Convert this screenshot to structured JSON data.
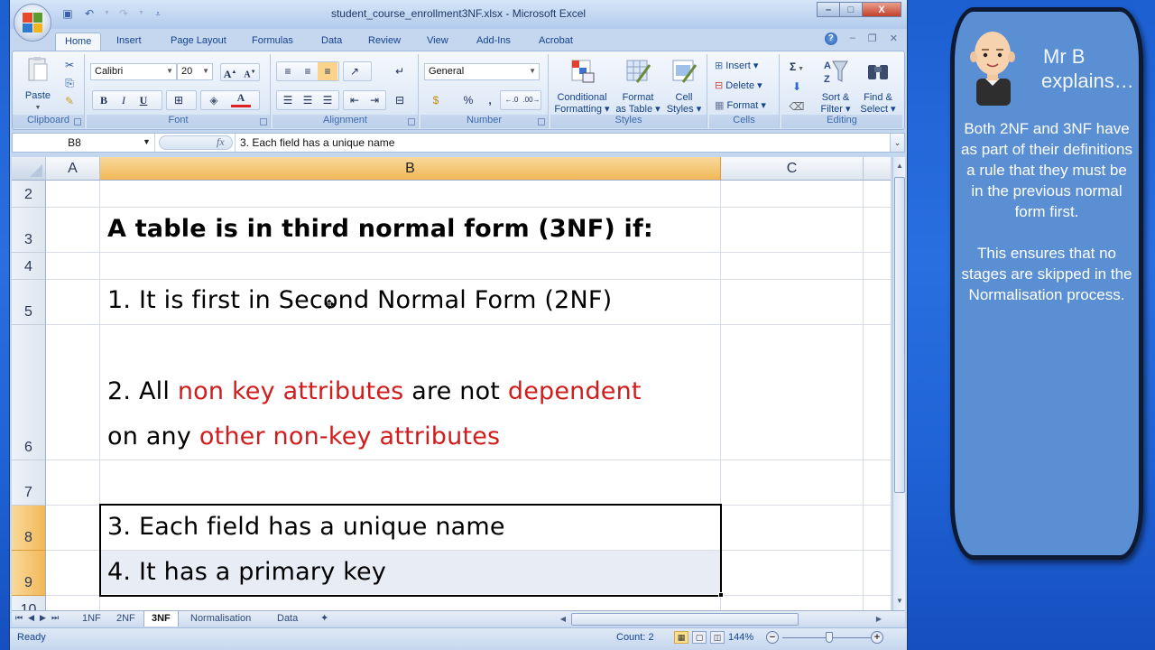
{
  "window": {
    "title": "student_course_enrollment3NF.xlsx - Microsoft Excel",
    "controls": {
      "minimize": "–",
      "maximize": "□",
      "close": "X"
    }
  },
  "quick_access": [
    "save-icon",
    "undo-icon",
    "redo-icon",
    "customize-icon"
  ],
  "ribbon_tabs": [
    {
      "label": "Home",
      "active": true
    },
    {
      "label": "Insert"
    },
    {
      "label": "Page Layout"
    },
    {
      "label": "Formulas"
    },
    {
      "label": "Data"
    },
    {
      "label": "Review"
    },
    {
      "label": "View"
    },
    {
      "label": "Add-Ins"
    },
    {
      "label": "Acrobat"
    }
  ],
  "ribbon": {
    "clipboard": {
      "label": "Clipboard",
      "paste": "Paste"
    },
    "font": {
      "label": "Font",
      "family": "Calibri",
      "size": "20",
      "bold": "B",
      "italic": "I",
      "underline": "U",
      "grow": "A",
      "shrink": "A",
      "font_color": "#e02020"
    },
    "alignment": {
      "label": "Alignment"
    },
    "number": {
      "label": "Number",
      "format": "General",
      "percent": "%",
      "comma": ","
    },
    "styles": {
      "label": "Styles",
      "conditional": [
        "Conditional",
        "Formatting ▾"
      ],
      "format_table": [
        "Format",
        "as Table ▾"
      ],
      "cell_styles": [
        "Cell",
        "Styles ▾"
      ]
    },
    "cells": {
      "label": "Cells",
      "insert": "Insert ▾",
      "delete": "Delete ▾",
      "format": "Format ▾"
    },
    "editing": {
      "label": "Editing",
      "sum": "Σ",
      "sort": [
        "Sort &",
        "Filter ▾"
      ],
      "find": [
        "Find &",
        "Select ▾"
      ]
    }
  },
  "formula_bar": {
    "name_box": "B8",
    "fx": "fx",
    "value": "3. Each field has a unique name"
  },
  "grid": {
    "columns": [
      "A",
      "B",
      "C"
    ],
    "selected_column": "B",
    "rows": [
      "2",
      "3",
      "4",
      "5",
      "6",
      "7",
      "8",
      "9",
      "10"
    ],
    "selected_rows": [
      "8",
      "9"
    ],
    "cells": {
      "b3": "A table is in third normal form (3NF) if:",
      "b5": "1. It is first in Second Normal Form (2NF)",
      "b6_line1": [
        {
          "text": "2. All ",
          "red": false
        },
        {
          "text": "non key attributes",
          "red": true
        },
        {
          "text": " are not ",
          "red": false
        },
        {
          "text": "dependent",
          "red": true
        }
      ],
      "b6_line2": [
        {
          "text": "on any ",
          "red": false
        },
        {
          "text": "other non-key attributes",
          "red": true
        }
      ],
      "b8": "3. Each field has a unique name",
      "b9": "4. It has a primary key"
    },
    "highlight_color": "#d01c1c"
  },
  "sheet_tabs": [
    {
      "label": "1NF"
    },
    {
      "label": "2NF"
    },
    {
      "label": "3NF",
      "active": true
    },
    {
      "label": "Normalisation"
    },
    {
      "label": "Data"
    }
  ],
  "status": {
    "mode": "Ready",
    "count": "Count: 2",
    "zoom": "144%"
  },
  "panel": {
    "title_line1": "Mr B",
    "title_line2": "explains…",
    "paragraph1": "Both 2NF and 3NF have as part of their definitions a rule that they must be in the previous normal form first.",
    "paragraph2": "This ensures that no stages are skipped in the Normalisation process."
  }
}
